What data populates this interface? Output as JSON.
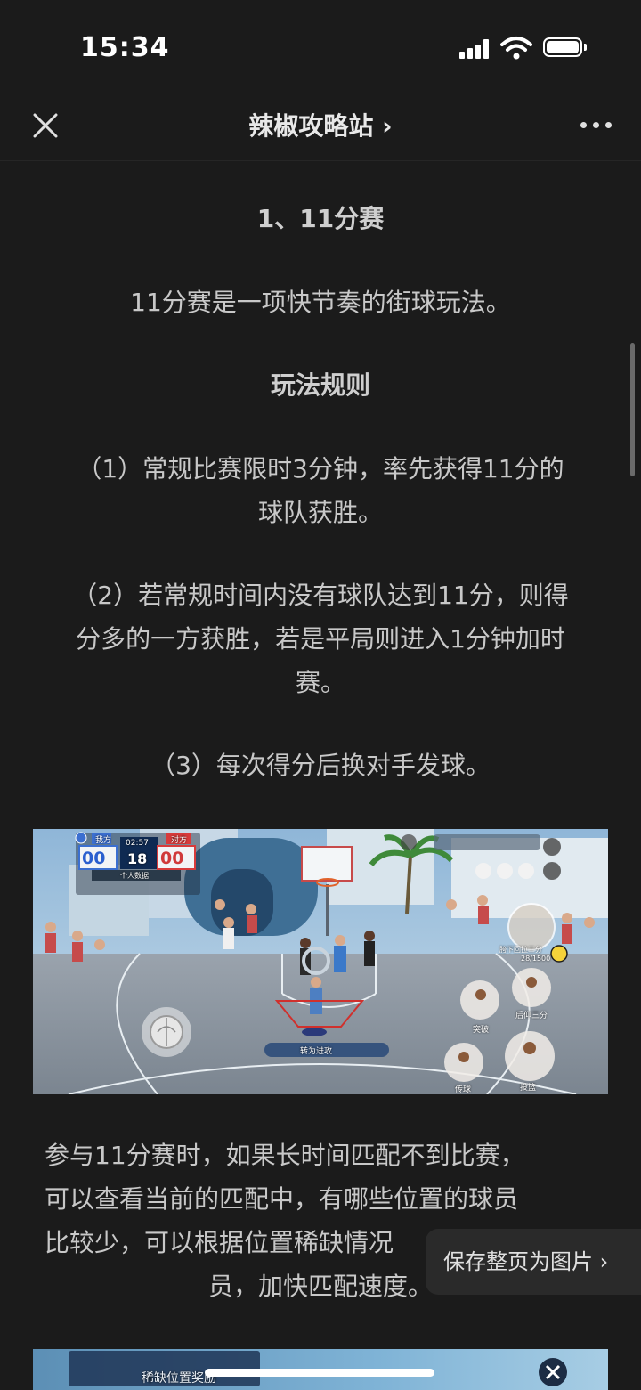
{
  "status": {
    "time": "15:34"
  },
  "nav": {
    "title": "辣椒攻略站 ›"
  },
  "article": {
    "heading": "1、11分赛",
    "intro": "11分赛是一项快节奏的街球玩法。",
    "rules_title": "玩法规则",
    "rule1_line1": "（1）常规比赛限时3分钟，率先获得11分的",
    "rule1_line2": "球队获胜。",
    "rule2_line1": "（2）若常规时间内没有球队达到11分，则得",
    "rule2_line2": "分多的一方获胜，若是平局则进入1分钟加时",
    "rule2_line3": "赛。",
    "rule3": "（3）每次得分后换对手发球。",
    "para_line1": "参与11分赛时，如果长时间匹配不到比赛，",
    "para_line2": "可以查看当前的匹配中，有哪些位置的球员",
    "para_line3": "比较少，可以根据位置稀缺情况",
    "para_line4": "员，加快匹配速度。"
  },
  "game": {
    "home_label": "我方",
    "away_label": "对方",
    "clock": "02:57",
    "shot_clock": "18",
    "home_score": "00",
    "away_score": "00",
    "stats_title": "个人数据",
    "action_label": "转为进攻",
    "skill_bar": "28/1500",
    "skill_name": "胯下回拉三分",
    "btn_breakthrough": "突破",
    "btn_fadeaway": "后仰三分",
    "btn_pass": "传球",
    "btn_shoot": "投篮",
    "banner_text": "稀缺位置奖励"
  },
  "save_button": {
    "label": "保存整页为图片 ›"
  }
}
